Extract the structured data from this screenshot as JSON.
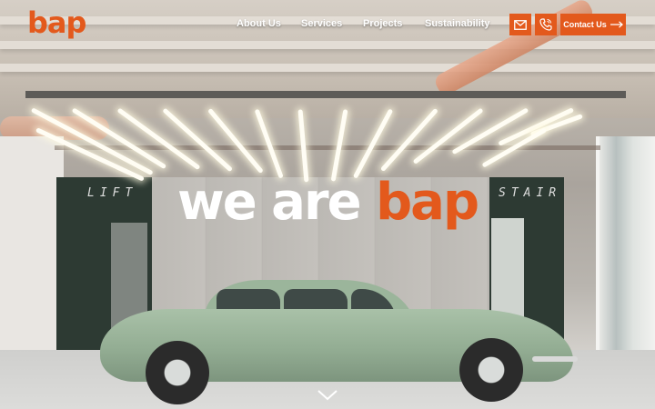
{
  "brand": {
    "logo_text": "bap",
    "accent_color": "#e3591c"
  },
  "nav": {
    "items": [
      {
        "label": "About Us"
      },
      {
        "label": "Services"
      },
      {
        "label": "Projects"
      },
      {
        "label": "Sustainability"
      }
    ],
    "icons": [
      "mail-icon",
      "phone-icon",
      "arrow-right-icon"
    ],
    "contact_label": "Contact Us"
  },
  "hero": {
    "headline_part1": "we are",
    "headline_part2": "bap",
    "sign_left": "LIFT",
    "sign_right": "STAIR"
  }
}
